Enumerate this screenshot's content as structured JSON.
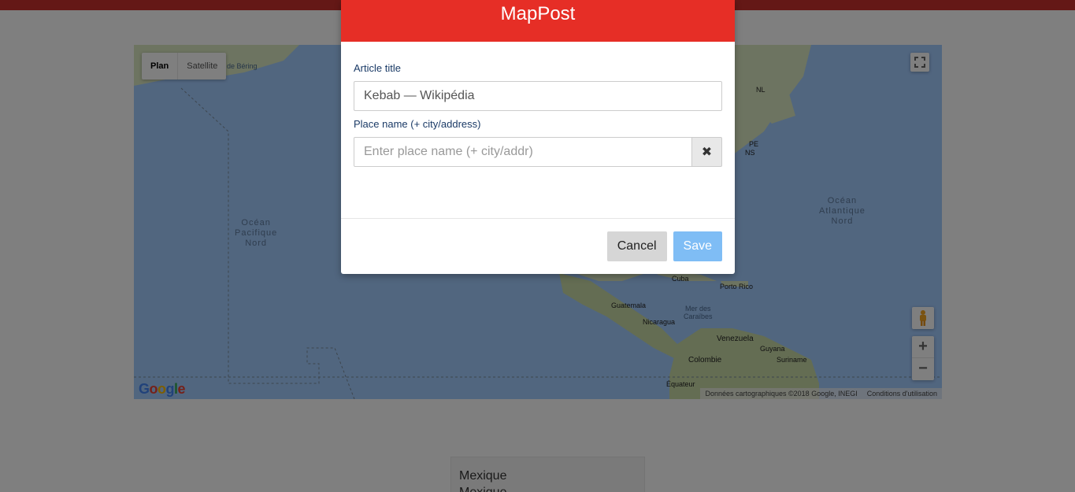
{
  "modal": {
    "title": "MapPost",
    "article_title_label": "Article title",
    "article_title_value": "Kebab — Wikipédia",
    "place_label": "Place name (+ city/address)",
    "place_placeholder": "Enter place name (+ city/addr)",
    "place_value": "",
    "clear_icon": "✖",
    "cancel_label": "Cancel",
    "save_label": "Save"
  },
  "map": {
    "type_buttons": [
      "Plan",
      "Satellite"
    ],
    "active_type": "Plan",
    "labels": {
      "pacific": "Océan\nPacifique\nNord",
      "atlantic": "Océan\nAtlantique\nNord",
      "bering": "de Béring",
      "nl": "NL",
      "pe": "PE",
      "ns": "NS",
      "cuba": "Cuba",
      "puerto_rico": "Porto Rico",
      "guatemala": "Guatemala",
      "nicaragua": "Nicaragua",
      "caribbean": "Mer des\nCaraïbes",
      "venezuela": "Venezuela",
      "guyana": "Guyana",
      "suriname": "Suriname",
      "colombia": "Colombie",
      "equator": "Équateur"
    },
    "logo": "Google",
    "attribution": "Données cartographiques ©2018 Google, INEGI",
    "terms": "Conditions d'utilisation",
    "zoom_in": "+",
    "zoom_out": "−"
  },
  "list": {
    "items": [
      "Mexique",
      "Mexique"
    ]
  },
  "colors": {
    "header_red": "#e62e26",
    "topbar_red": "#c9302c",
    "save_blue": "#7fbdf5",
    "ocean": "#a3ccff",
    "land": "#dbe8c2"
  },
  "icons": {
    "clear": "close-icon",
    "fullscreen": "fullscreen-icon",
    "pegman": "pegman-icon"
  }
}
